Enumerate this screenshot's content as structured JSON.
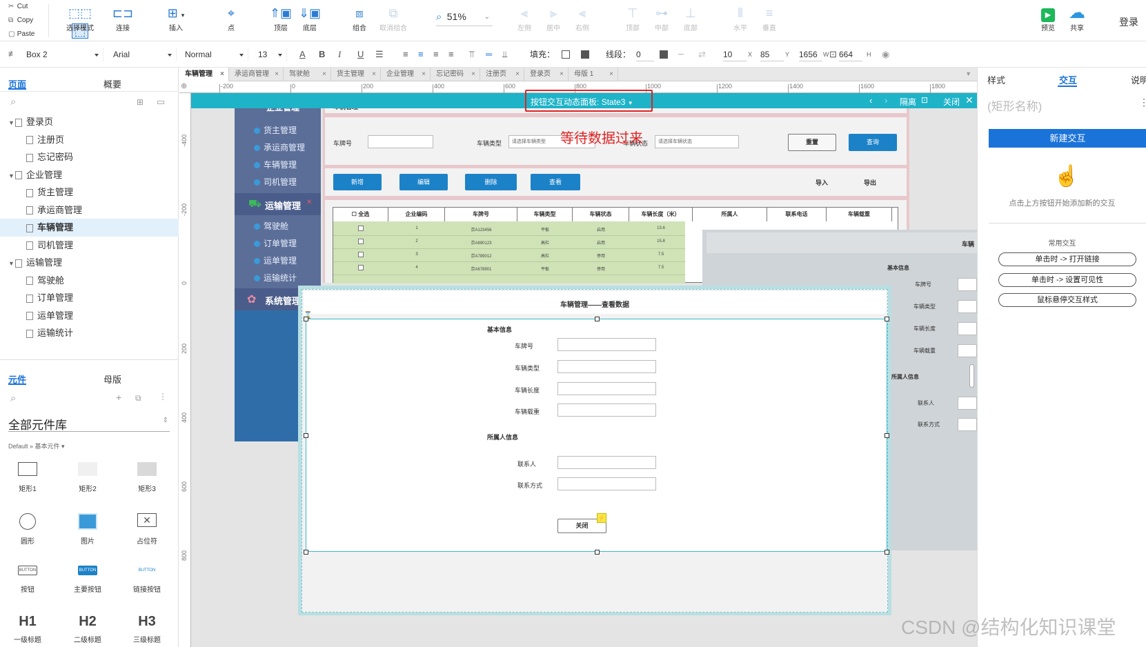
{
  "toolbar": {
    "clipboard": {
      "cut": "Cut",
      "copy": "Copy",
      "paste": "Paste"
    },
    "buttons": [
      {
        "label": "选择模式",
        "icon": "select-mode-icon"
      },
      {
        "label": "连接",
        "icon": "connect-icon"
      },
      {
        "label": "插入",
        "icon": "insert-icon"
      },
      {
        "label": "点",
        "icon": "point-icon"
      },
      {
        "label": "顶层",
        "icon": "bring-front-icon"
      },
      {
        "label": "底层",
        "icon": "send-back-icon"
      },
      {
        "label": "组合",
        "icon": "group-icon"
      },
      {
        "label": "取消组合",
        "icon": "ungroup-icon"
      }
    ],
    "zoom": "51%",
    "align_buttons": [
      "左侧",
      "居中",
      "右侧",
      "顶部",
      "中部",
      "底部",
      "水平",
      "垂直"
    ],
    "preview": "预览",
    "share": "共享",
    "login": "登录"
  },
  "format": {
    "element_name": "Box 2",
    "font": "Arial",
    "style": "Normal",
    "size": "13",
    "fill_label": "填充：",
    "line_label": "线段：",
    "line_value": "0",
    "x": "10",
    "x_label": "X",
    "y": "85",
    "y_label": "Y",
    "w": "1656",
    "w_label": "W",
    "h": "664",
    "h_label": "H"
  },
  "left": {
    "tabs": [
      "页面",
      "概要"
    ],
    "pages": [
      {
        "label": "登录页",
        "level": 0,
        "folder": true
      },
      {
        "label": "注册页",
        "level": 1
      },
      {
        "label": "忘记密码",
        "level": 1
      },
      {
        "label": "企业管理",
        "level": 0,
        "folder": true
      },
      {
        "label": "货主管理",
        "level": 1
      },
      {
        "label": "承运商管理",
        "level": 1
      },
      {
        "label": "车辆管理",
        "level": 1,
        "active": true
      },
      {
        "label": "司机管理",
        "level": 1
      },
      {
        "label": "运输管理",
        "level": 0,
        "folder": true
      },
      {
        "label": "驾驶舱",
        "level": 1
      },
      {
        "label": "订单管理",
        "level": 1
      },
      {
        "label": "运单管理",
        "level": 1
      },
      {
        "label": "运输统计",
        "level": 1
      }
    ],
    "lib_tabs": [
      "元件",
      "母版"
    ],
    "library_title": "全部元件库",
    "library_path": "Default » 基本元件 ▾",
    "widgets": [
      "矩形1",
      "矩形2",
      "矩形3",
      "圆形",
      "图片",
      "占位符",
      "按钮",
      "主要按钮",
      "链接按钮",
      "一级标题",
      "二级标题",
      "三级标题"
    ],
    "widget_previews": {
      "button": "BUTTON",
      "h1": "H1",
      "h2": "H2",
      "h3": "H3"
    }
  },
  "tabs": [
    "车辆管理",
    "承运商管理",
    "驾驶舱",
    "货主管理",
    "企业管理",
    "忘记密码",
    "注册页",
    "登录页",
    "母版 1"
  ],
  "ruler_top": [
    "-200",
    "0",
    "200",
    "400",
    "600",
    "800",
    "1000",
    "1200",
    "1400",
    "1600",
    "1800"
  ],
  "ruler_left": [
    "-400",
    "-200",
    "0",
    "200",
    "400",
    "600",
    "800"
  ],
  "dynamic_panel": {
    "label": "按钮交互动态面板:",
    "state": "State3",
    "isolate": "隔离",
    "close": "关闭"
  },
  "annotation": "等待数据过来",
  "design": {
    "sidebar": {
      "top_group": "企业管理",
      "items_a": [
        "货主管理",
        "承运商管理",
        "车辆管理",
        "司机管理"
      ],
      "group2": "运输管理",
      "items_b": [
        "驾驶舱",
        "订单管理",
        "运单管理",
        "运输统计"
      ],
      "group3": "系统管理"
    },
    "page_header": "车辆管理",
    "filters": {
      "plate": "车牌号",
      "type": "车辆类型",
      "type_ph": "请选择车辆类型",
      "status": "车辆状态",
      "status_ph": "请选择车辆状态",
      "reset": "重置",
      "search": "查询"
    },
    "actions": [
      "新增",
      "编辑",
      "删除",
      "查看"
    ],
    "import": "导入",
    "export": "导出",
    "table": {
      "headers": [
        "全选",
        "企业编码",
        "车牌号",
        "车辆类型",
        "车辆状态",
        "车辆长度（米）",
        "所属人",
        "联系电话",
        "车辆载重"
      ],
      "rows": [
        [
          "1",
          "京A123456",
          "平板",
          "启用",
          "13.6"
        ],
        [
          "2",
          "京A890123",
          "高栏",
          "启用",
          "15.8"
        ],
        [
          "3",
          "京A789012",
          "高栏",
          "停用",
          "7.5"
        ],
        [
          "4",
          "京A678901",
          "平板",
          "停用",
          "7.5"
        ]
      ]
    },
    "modal": {
      "title": "车辆管理——查看数据",
      "section1": "基本信息",
      "fields1": [
        "车牌号",
        "车辆类型",
        "车辆长度",
        "车辆载重"
      ],
      "section2": "所属人信息",
      "fields2": [
        "联系人",
        "联系方式"
      ],
      "close": "关闭"
    },
    "bg_form": {
      "title": "车辆",
      "section1": "基本信息",
      "fields1": [
        "车牌号",
        "车辆类型",
        "车辆长度",
        "车辆载重"
      ],
      "section2": "所属人信息",
      "fields2": [
        "联系人",
        "联系方式"
      ]
    }
  },
  "right": {
    "tabs": [
      "样式",
      "交互",
      "说明"
    ],
    "name_placeholder": "(矩形名称)",
    "new_interaction": "新建交互",
    "hint": "点击上方按钮开始添加新的交互",
    "common_title": "常用交互",
    "common": [
      "单击时 -> 打开链接",
      "单击时 -> 设置可见性",
      "鼠标悬停交互样式"
    ]
  },
  "watermark": "CSDN @结构化知识课堂"
}
